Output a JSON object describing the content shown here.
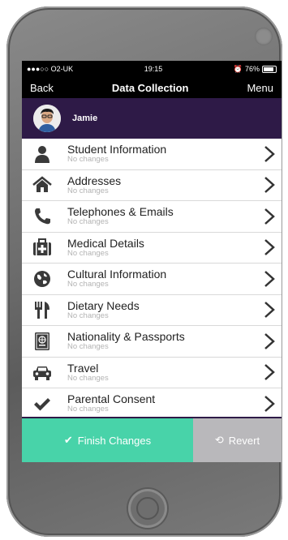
{
  "status": {
    "carrier": "●●●○○ O2-UK",
    "time": "19:15",
    "battery": "76%"
  },
  "nav": {
    "back": "Back",
    "title": "Data Collection",
    "menu": "Menu"
  },
  "profile": {
    "name": "Jamie"
  },
  "items": [
    {
      "label": "Student Information",
      "sub": "No changes",
      "icon": "person-icon"
    },
    {
      "label": "Addresses",
      "sub": "No changes",
      "icon": "home-icon"
    },
    {
      "label": "Telephones & Emails",
      "sub": "No changes",
      "icon": "phone-icon"
    },
    {
      "label": "Medical Details",
      "sub": "No changes",
      "icon": "medical-kit-icon"
    },
    {
      "label": "Cultural Information",
      "sub": "No changes",
      "icon": "globe-icon"
    },
    {
      "label": "Dietary Needs",
      "sub": "No changes",
      "icon": "cutlery-icon"
    },
    {
      "label": "Nationality & Passports",
      "sub": "No changes",
      "icon": "passport-icon"
    },
    {
      "label": "Travel",
      "sub": "No changes",
      "icon": "car-icon"
    },
    {
      "label": "Parental Consent",
      "sub": "No changes",
      "icon": "check-icon"
    }
  ],
  "actions": {
    "finish": "Finish Changes",
    "revert": "Revert"
  },
  "colors": {
    "profile_bg": "#2e1a47",
    "finish_bg": "#48d3a9",
    "revert_bg": "#b9b8bb"
  }
}
